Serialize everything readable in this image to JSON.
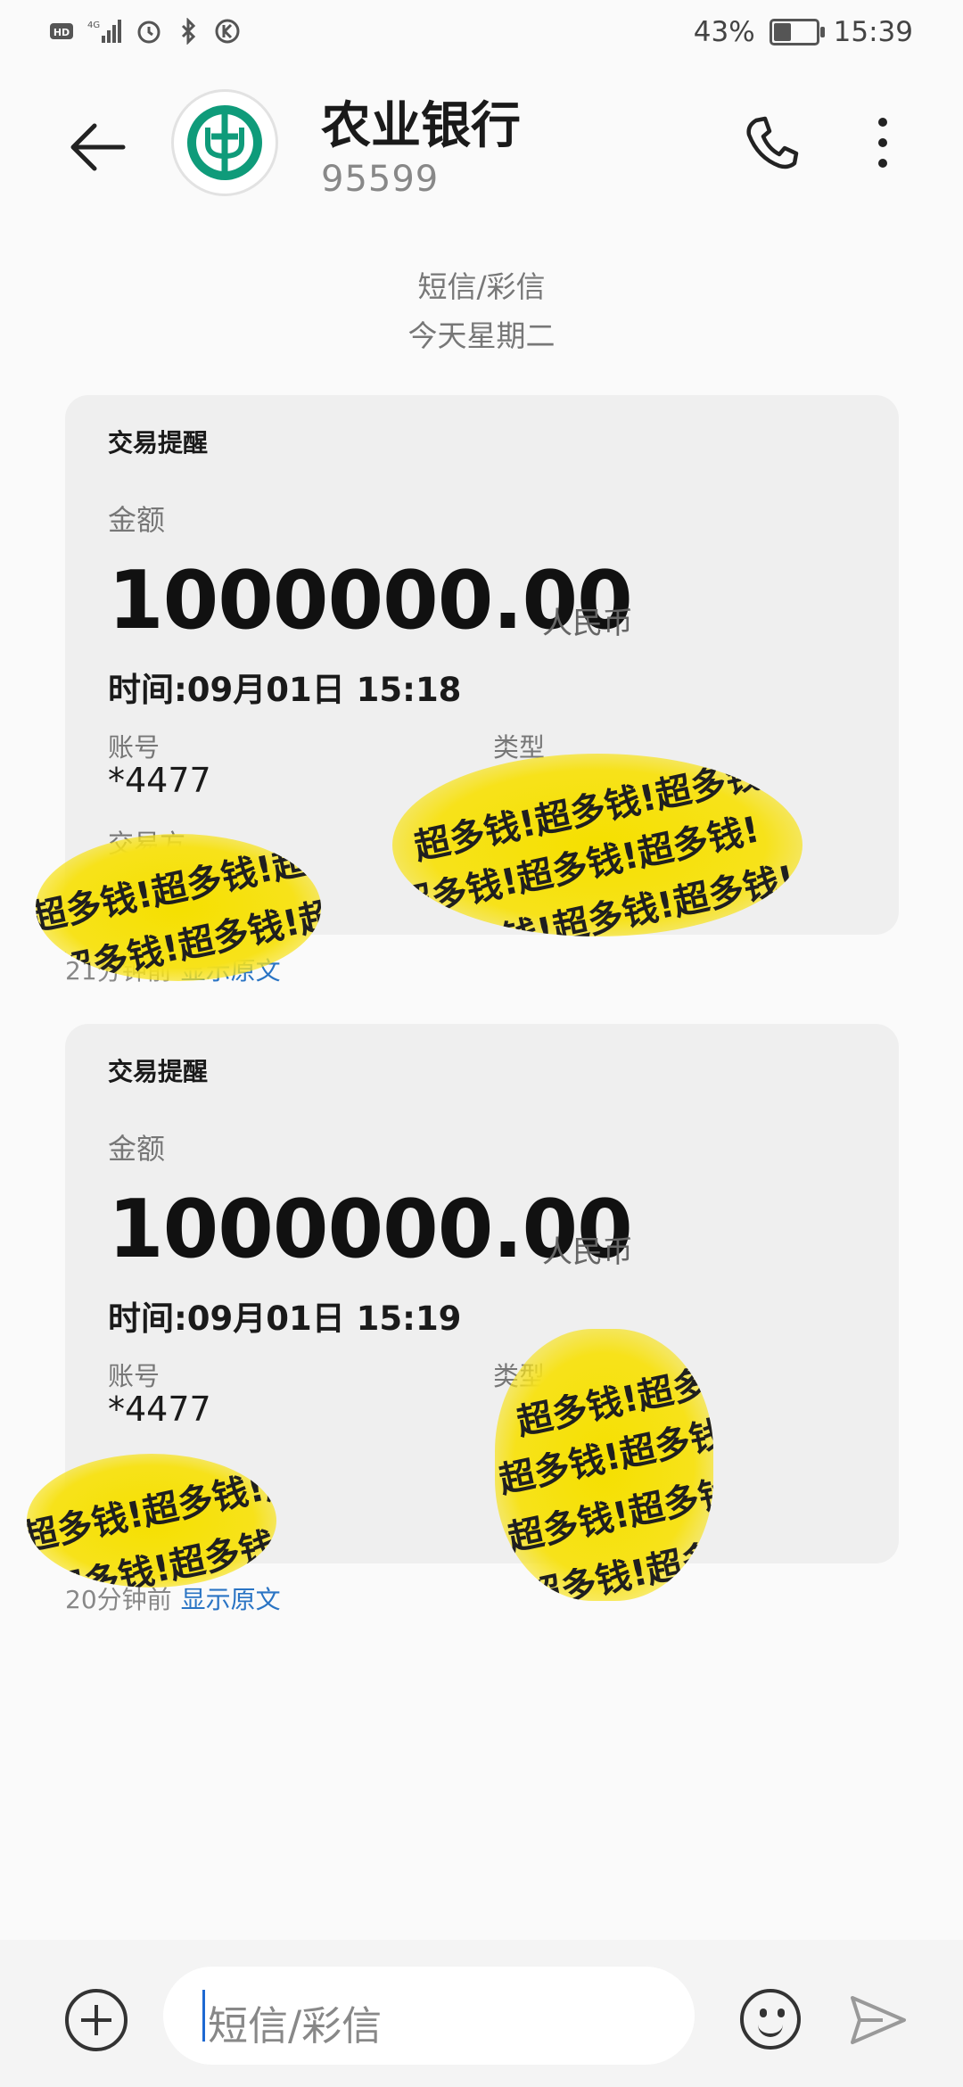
{
  "status": {
    "battery": "43%",
    "battery_level": 0.43,
    "time": "15:39",
    "network": "4G"
  },
  "header": {
    "title": "农业银行",
    "number": "95599"
  },
  "thread": {
    "channel": "短信/彩信",
    "day": "今天星期二"
  },
  "messages": [
    {
      "title": "交易提醒",
      "amount_label": "金额",
      "amount": "1000000.00",
      "currency": "人民币",
      "time": "时间:09月01日 15:18",
      "account_label": "账号",
      "account": "*4477",
      "type_label": "类型",
      "counterparty_label": "交易方",
      "age": "21分钟前",
      "show_original": "显示原文"
    },
    {
      "title": "交易提醒",
      "amount_label": "金额",
      "amount": "1000000.00",
      "currency": "人民币",
      "time": "时间:09月01日 15:19",
      "account_label": "账号",
      "account": "*4477",
      "type_label": "类型",
      "age": "20分钟前",
      "show_original": "显示原文"
    }
  ],
  "overlay_text": "超多钱!超多钱!超多钱!",
  "composer": {
    "placeholder": "短信/彩信"
  },
  "colors": {
    "link": "#2a74c4",
    "brand_green": "#0f9b7a",
    "sticker_yellow": "#f5e000"
  }
}
